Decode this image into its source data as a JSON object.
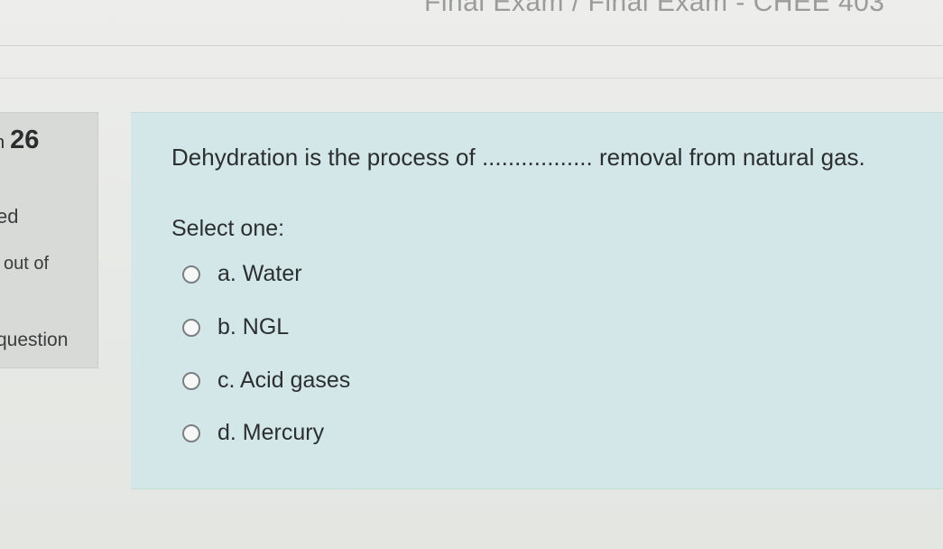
{
  "breadcrumb": {
    "text": "Final Exam / Final Exam - CHEE 403"
  },
  "info": {
    "question_word": "n",
    "question_number": "26",
    "state": "ed",
    "mark": "out of",
    "flag": "question"
  },
  "question": {
    "text": "Dehydration is the process of ................. removal from natural gas.",
    "prompt": "Select one:",
    "options": [
      {
        "label": "a. Water",
        "selected": false
      },
      {
        "label": "b. NGL",
        "selected": false
      },
      {
        "label": "c. Acid gases",
        "selected": false
      },
      {
        "label": "d. Mercury",
        "selected": false
      }
    ]
  },
  "colors": {
    "question_bg": "#d3e7e8",
    "info_bg": "#d8dad8",
    "page_bg": "#e9ebe8"
  }
}
